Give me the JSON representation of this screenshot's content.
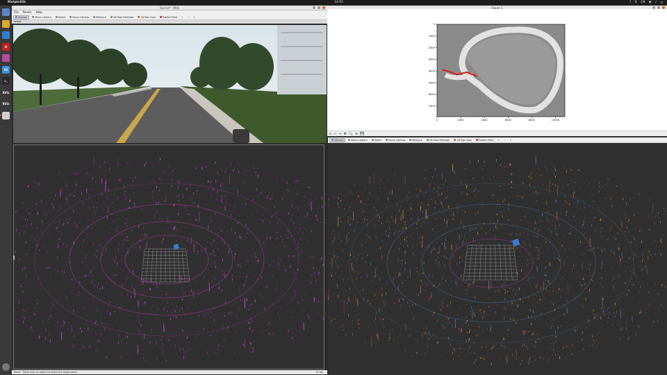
{
  "topbar": {
    "app_name": "Matplotlib",
    "clock": "14:05",
    "tray": [
      "?",
      "⇅",
      "CN",
      "◉",
      "♪",
      "⏻"
    ]
  },
  "dock": [
    {
      "icon": "files-icon",
      "label": "",
      "color": "#5b86c6"
    },
    {
      "icon": "chrome-icon",
      "label": "",
      "color": "#e0a82e"
    },
    {
      "icon": "vscode-icon",
      "label": "",
      "color": "#2f7fcf"
    },
    {
      "icon": "acrobat-icon",
      "label": "A",
      "color": "#c8201e"
    },
    {
      "icon": "app-icon",
      "label": "",
      "color": "#b84a9a"
    },
    {
      "icon": "v2-icon",
      "label": "V2",
      "color": "#3b8fd5"
    },
    {
      "icon": "terminal-icon",
      "label": ">_",
      "color": "#2b2b2b"
    },
    {
      "icon": "rviz-icon",
      "label": "RViz",
      "color": "#3a3a3a"
    },
    {
      "icon": "rviz-icon-2",
      "label": "RViz",
      "color": "#3a3a3a"
    },
    {
      "icon": "tool-icon",
      "label": "",
      "color": "#cfcfcf"
    }
  ],
  "rviz1": {
    "title": "lio.rviz* - RViz",
    "menu": [
      "File",
      "Panels",
      "Help"
    ],
    "tools": [
      {
        "label": "Interact",
        "icon_color": "#6a8fc2",
        "pressed": true
      },
      {
        "label": "Move Camera",
        "icon_color": "#888",
        "pressed": false
      },
      {
        "label": "Select",
        "icon_color": "#888",
        "pressed": false
      },
      {
        "label": "Focus Camera",
        "icon_color": "#888",
        "pressed": false
      },
      {
        "label": "Measure",
        "icon_color": "#888",
        "pressed": false
      },
      {
        "label": "2D Pose Estimate",
        "icon_color": "#4caf50",
        "pressed": false
      },
      {
        "label": "2D Nav Goal",
        "icon_color": "#b06b2b",
        "pressed": false
      },
      {
        "label": "Publish Point",
        "icon_color": "#c0392b",
        "pressed": false
      }
    ],
    "image_panel_title": "Image",
    "status_left": "Reset",
    "status_hint": "Move over an object to select the target point.",
    "fps": "31 fps"
  },
  "figure": {
    "title": "Figure 1",
    "toolbar_icons": [
      "⌂",
      "←",
      "→",
      "✥",
      "🔍",
      "≡",
      "💾"
    ]
  },
  "rviz2": {
    "tools": [
      {
        "label": "Interact",
        "icon_color": "#6a8fc2",
        "pressed": true
      },
      {
        "label": "Move Camera",
        "icon_color": "#888",
        "pressed": false
      },
      {
        "label": "Select",
        "icon_color": "#888",
        "pressed": false
      },
      {
        "label": "Focus Camera",
        "icon_color": "#888",
        "pressed": false
      },
      {
        "label": "Measure",
        "icon_color": "#888",
        "pressed": false
      },
      {
        "label": "2D Pose Estimate",
        "icon_color": "#4caf50",
        "pressed": false
      },
      {
        "label": "2D Nav Goal",
        "icon_color": "#b06b2b",
        "pressed": false
      },
      {
        "label": "Publish Point",
        "icon_color": "#c0392b",
        "pressed": false
      }
    ]
  },
  "chart_data": {
    "type": "heatmap",
    "x_ticks": [
      0,
      2000,
      4000,
      6000,
      8000,
      10000
    ],
    "y_ticks": [
      0,
      1000,
      2000,
      3000,
      4000,
      5000,
      6000,
      7000
    ],
    "xlim": [
      0,
      10800
    ],
    "ylim": [
      7900,
      0
    ],
    "trajectory": {
      "color": "#d7261e",
      "x": [
        500,
        900,
        1300,
        1700,
        2100,
        2500,
        2900,
        3300
      ],
      "y": [
        3900,
        4000,
        4150,
        4300,
        4200,
        4100,
        4250,
        4400
      ]
    }
  }
}
